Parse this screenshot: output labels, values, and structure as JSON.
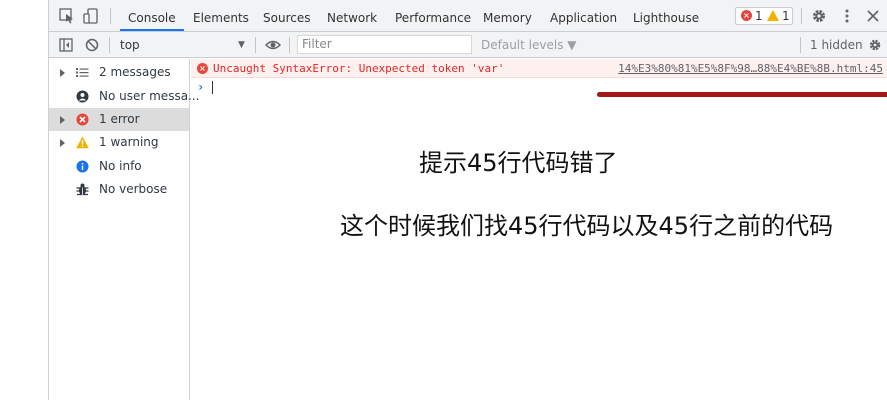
{
  "tabs": [
    "Console",
    "Elements",
    "Sources",
    "Network",
    "Performance",
    "Memory",
    "Application",
    "Lighthouse"
  ],
  "issues": {
    "errors": "1",
    "warnings": "1"
  },
  "toolbar": {
    "context": "top",
    "filter_placeholder": "Filter",
    "levels": "Default levels ▼",
    "hidden": "1 hidden"
  },
  "sidebar": {
    "items": [
      {
        "label": "2 messages",
        "icon": "list-icon"
      },
      {
        "label": "No user messa...",
        "icon": "user-icon"
      },
      {
        "label": "1 error",
        "icon": "error-icon"
      },
      {
        "label": "1 warning",
        "icon": "warning-icon"
      },
      {
        "label": "No info",
        "icon": "info-icon"
      },
      {
        "label": "No verbose",
        "icon": "bug-icon"
      }
    ]
  },
  "console": {
    "error_message": "Uncaught SyntaxError: Unexpected token 'var'",
    "error_source": "14%E3%80%81%E5%8F%98…88%E4%BE%8B.html:45",
    "prompt": "›"
  },
  "annotations": {
    "line1": "提示45行代码错了",
    "line2": "这个时候我们找45行代码以及45行之前的代码"
  },
  "colors": {
    "accent": "#1a73e8",
    "error": "#e8453c",
    "warning": "#f0b400",
    "underline_mark": "#a01818"
  }
}
